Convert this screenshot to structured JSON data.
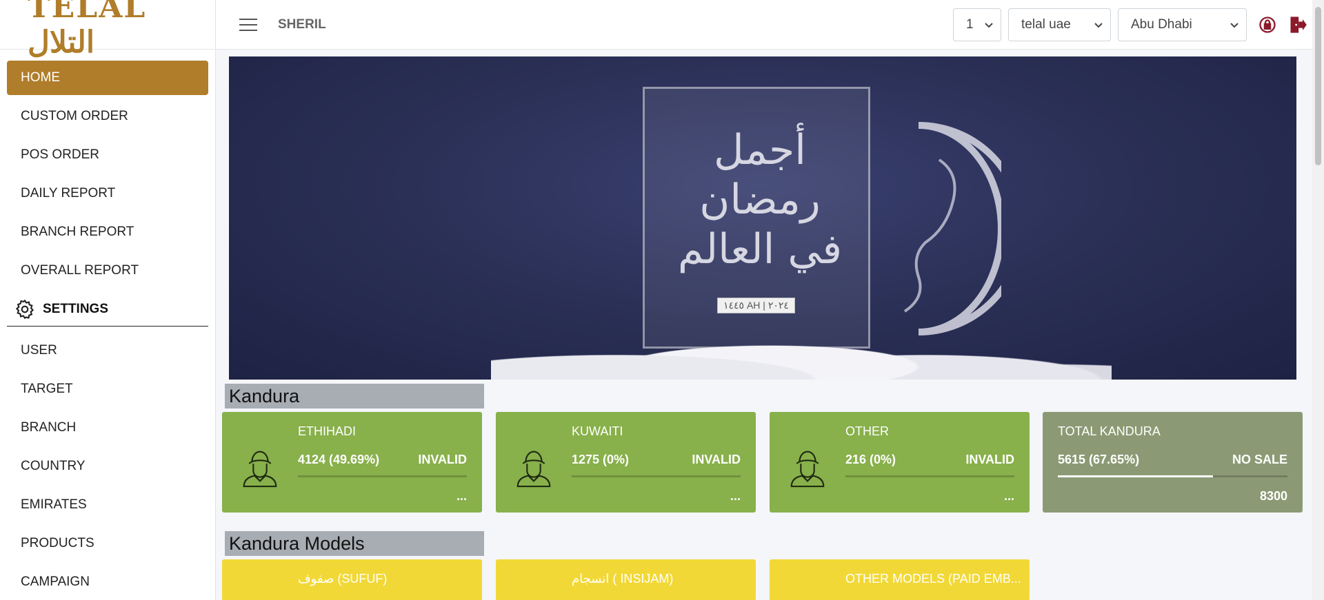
{
  "brand": {
    "logo_text": "TELAL التلال"
  },
  "sidebar": {
    "items": [
      {
        "label": "HOME",
        "active": true
      },
      {
        "label": "CUSTOM ORDER"
      },
      {
        "label": "POS ORDER"
      },
      {
        "label": "DAILY REPORT"
      },
      {
        "label": "BRANCH REPORT"
      },
      {
        "label": "OVERALL REPORT"
      }
    ],
    "settings_label": "SETTINGS",
    "settings_items": [
      {
        "label": "USER"
      },
      {
        "label": "TARGET"
      },
      {
        "label": "BRANCH"
      },
      {
        "label": "COUNTRY"
      },
      {
        "label": "EMIRATES"
      },
      {
        "label": "PRODUCTS"
      },
      {
        "label": "CAMPAIGN"
      }
    ]
  },
  "header": {
    "user": "SHERIL",
    "select_1": "1",
    "select_2": "telal uae",
    "select_3": "Abu Dhabi"
  },
  "banner": {
    "arabic_text": "أجمل رمضان في العالم",
    "tag": "١٤٤٥ AH | ٢٠٢٤"
  },
  "kandura": {
    "title": "Kandura",
    "cards": [
      {
        "name": "ETHIHADI",
        "value": "4124 (49.69%)",
        "status": "INVALID",
        "progress": 0,
        "footer": "..."
      },
      {
        "name": "KUWAITI",
        "value": "1275 (0%)",
        "status": "INVALID",
        "progress": 0,
        "footer": "..."
      },
      {
        "name": "OTHER",
        "value": "216 (0%)",
        "status": "INVALID",
        "progress": 0,
        "footer": "..."
      }
    ],
    "total": {
      "name": "TOTAL KANDURA",
      "value": "5615 (67.65%)",
      "status": "NO SALE",
      "progress": 0.6765,
      "footer": "8300"
    }
  },
  "models": {
    "title": "Kandura Models",
    "cards": [
      {
        "name": "صفوف (SUFUF)"
      },
      {
        "name": "انسجام ( INSIJAM)"
      },
      {
        "name": "OTHER MODELS (PAID EMB..."
      }
    ]
  },
  "colors": {
    "accent": "#b07d2b",
    "card_green": "#88b04b",
    "card_olive": "#8b9a74",
    "card_yellow": "#f2d837"
  }
}
